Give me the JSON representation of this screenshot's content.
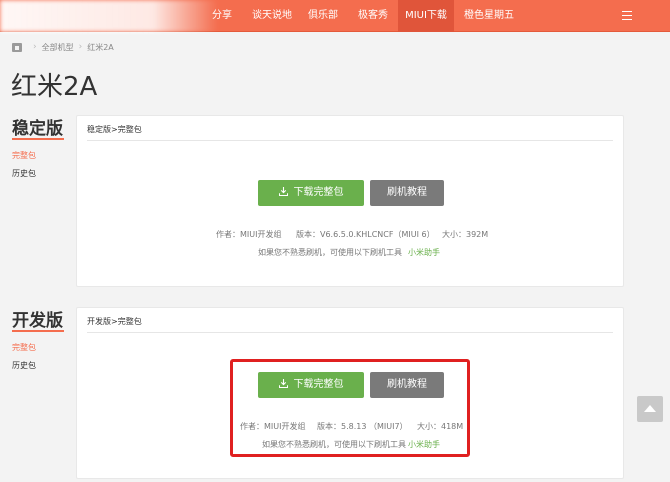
{
  "nav": {
    "items": [
      {
        "label": "分享"
      },
      {
        "label": "谈天说地"
      },
      {
        "label": "俱乐部"
      },
      {
        "label": "极客秀"
      },
      {
        "label": "MIUI下载"
      },
      {
        "label": "橙色星期五"
      }
    ],
    "active_index": 4,
    "menu_icon": "menu-icon"
  },
  "breadcrumb": {
    "home_icon": "home-icon",
    "items": [
      "全部机型",
      "红米2A"
    ]
  },
  "page_title": "红米2A",
  "sections": [
    {
      "title": "稳定版",
      "links": [
        {
          "label": "完整包",
          "active": true
        },
        {
          "label": "历史包",
          "active": false
        }
      ],
      "panel_heading": "稳定版>完整包",
      "download_label": "下载完整包",
      "tutorial_label": "刷机教程",
      "author": "作者：MIUI开发组",
      "version": "版本：V6.6.5.0.KHLCNCF（MIUI 6）",
      "size": "大小：392M",
      "hint": "如果您不熟悉刷机，可使用以下刷机工具",
      "tool_link": "小米助手"
    },
    {
      "title": "开发版",
      "links": [
        {
          "label": "完整包",
          "active": true
        },
        {
          "label": "历史包",
          "active": false
        }
      ],
      "panel_heading": "开发版>完整包",
      "download_label": "下载完整包",
      "tutorial_label": "刷机教程",
      "author": "作者：MIUI开发组",
      "version": "版本：5.8.13 （MIUI7）",
      "size": "大小：418M",
      "hint": "如果您不熟悉刷机，可使用以下刷机工具",
      "tool_link": "小米助手"
    }
  ],
  "colors": {
    "accent": "#f46d4e",
    "download": "#6ab04c",
    "tutorial": "#7a7a7a",
    "highlight": "#e02020"
  }
}
